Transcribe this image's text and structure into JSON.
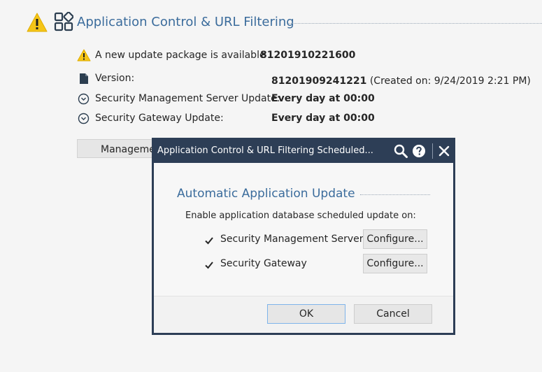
{
  "page": {
    "title": "Application Control & URL Filtering",
    "update_notice": {
      "label": "A new update package is available",
      "package": "81201910221600"
    },
    "rows": [
      {
        "icon": "document-icon",
        "label": "Version:",
        "value": "81201909241221",
        "extra": " (Created on: 9/24/2019 2:21 PM)"
      },
      {
        "icon": "clock-icon",
        "label": "Security Management Server Update:",
        "value": "Every day at 00:00"
      },
      {
        "icon": "clock-icon",
        "label": "Security Gateway Update:",
        "value": "Every day at 00:00"
      }
    ],
    "management_button_label": "Manageme"
  },
  "dialog": {
    "title": "Application Control & URL Filtering Scheduled...",
    "section_title": "Automatic Application Update",
    "description": "Enable application database scheduled update on:",
    "options": [
      {
        "label": "Security Management Server",
        "checked": true,
        "configure_label": "Configure..."
      },
      {
        "label": "Security Gateway",
        "checked": true,
        "configure_label": "Configure..."
      }
    ],
    "ok_label": "OK",
    "cancel_label": "Cancel"
  },
  "colors": {
    "accent_blue": "#3b6c9c",
    "dialog_frame": "#2d3e56",
    "warning_yellow": "#f5c518",
    "ok_focus_border": "#7eb4ea"
  }
}
